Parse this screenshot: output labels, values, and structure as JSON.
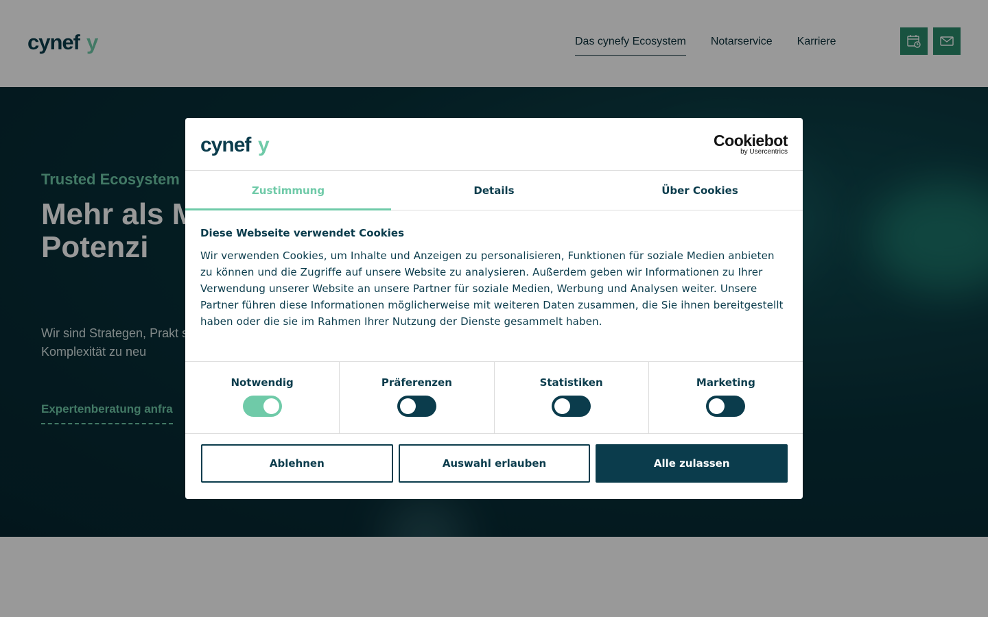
{
  "header": {
    "logo_text": "cynefy",
    "nav": [
      {
        "label": "Das cynefy Ecosystem",
        "active": true
      },
      {
        "label": "Notarservice",
        "active": false
      },
      {
        "label": "Karriere",
        "active": false
      }
    ],
    "calendar_icon": "calendar-icon",
    "mail_icon": "mail-icon"
  },
  "hero": {
    "eyebrow": "Trusted Ecosystem",
    "title_visible": "Mehr als M Services: IT-Potenzi",
    "text_visible": "Wir sind Strategen, Prakt sind IT-Experten. Und füh der IT-Komplexität zu neu",
    "link_label": "Expertenberatung anfra"
  },
  "dialog": {
    "logo_text": "cynefy",
    "brand_name": "Cookiebot",
    "brand_sub": "by Usercentrics",
    "tabs": [
      "Zustimmung",
      "Details",
      "Über Cookies"
    ],
    "active_tab": 0,
    "heading": "Diese Webseite verwendet Cookies",
    "text": "Wir verwenden Cookies, um Inhalte und Anzeigen zu personalisieren, Funktionen für soziale Medien anbieten zu können und die Zugriffe auf unsere Website zu analysieren. Außerdem geben wir Informationen zu Ihrer Verwendung unserer Website an unsere Partner für soziale Medien, Werbung und Analysen weiter. Unsere Partner führen diese Informationen möglicherweise mit weiteren Daten zusammen, die Sie ihnen bereitgestellt haben oder die sie im Rahmen Ihrer Nutzung der Dienste gesammelt haben.",
    "toggles": [
      {
        "label": "Notwendig",
        "on": true
      },
      {
        "label": "Präferenzen",
        "on": false
      },
      {
        "label": "Statistiken",
        "on": false
      },
      {
        "label": "Marketing",
        "on": false
      }
    ],
    "buttons": {
      "reject": "Ablehnen",
      "allow_selection": "Auswahl erlauben",
      "allow_all": "Alle zulassen"
    }
  },
  "colors": {
    "brand_dark": "#0b3c4c",
    "brand_green": "#6fcaa8",
    "header_button": "#2b8a6c"
  }
}
